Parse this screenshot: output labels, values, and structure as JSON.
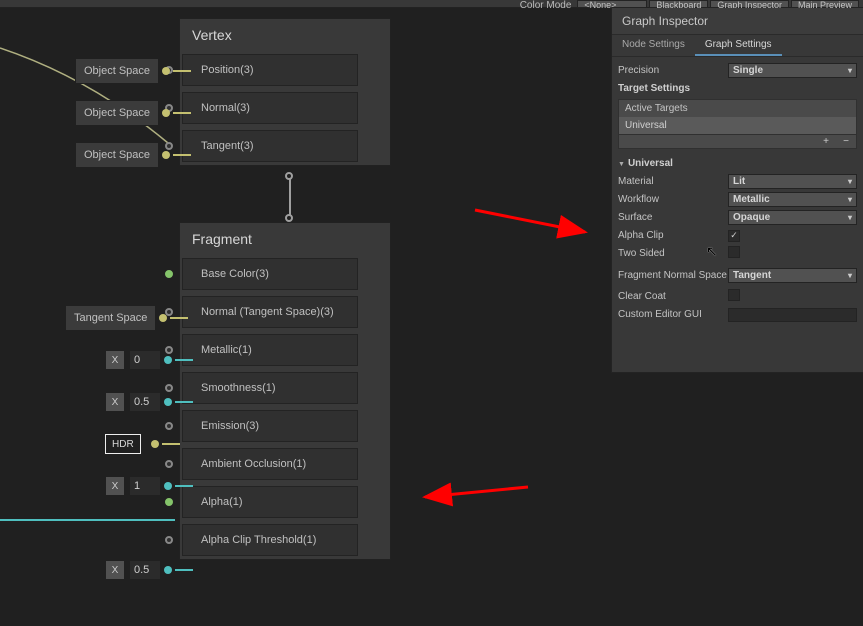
{
  "toolbar": {
    "colorModeLabel": "Color Mode",
    "colorModeValue": "<None>",
    "blackboard": "Blackboard",
    "graphInspector": "Graph Inspector",
    "mainPreview": "Main Preview"
  },
  "vertex": {
    "title": "Vertex",
    "ports": [
      {
        "label": "Position(3)",
        "ext": "Object Space"
      },
      {
        "label": "Normal(3)",
        "ext": "Object Space"
      },
      {
        "label": "Tangent(3)",
        "ext": "Object Space"
      }
    ]
  },
  "fragment": {
    "title": "Fragment",
    "ports": [
      {
        "label": "Base Color(3)",
        "extType": "color"
      },
      {
        "label": "Normal (Tangent Space)(3)",
        "extType": "chip",
        "ext": "Tangent Space"
      },
      {
        "label": "Metallic(1)",
        "extType": "num",
        "ext": "0"
      },
      {
        "label": "Smoothness(1)",
        "extType": "num",
        "ext": "0.5"
      },
      {
        "label": "Emission(3)",
        "extType": "hdr",
        "ext": "HDR"
      },
      {
        "label": "Ambient Occlusion(1)",
        "extType": "num",
        "ext": "1"
      },
      {
        "label": "Alpha(1)",
        "extType": "wire"
      },
      {
        "label": "Alpha Clip Threshold(1)",
        "extType": "num",
        "ext": "0.5"
      }
    ]
  },
  "inspector": {
    "title": "Graph Inspector",
    "tabs": {
      "node": "Node Settings",
      "graph": "Graph Settings"
    },
    "precisionLabel": "Precision",
    "precisionValue": "Single",
    "targetSettings": "Target Settings",
    "activeTargets": "Active Targets",
    "targetItem": "Universal",
    "foldUniversal": "Universal",
    "rows": {
      "materialLabel": "Material",
      "materialValue": "Lit",
      "workflowLabel": "Workflow",
      "workflowValue": "Metallic",
      "surfaceLabel": "Surface",
      "surfaceValue": "Opaque",
      "alphaClipLabel": "Alpha Clip",
      "alphaClipChecked": "✓",
      "twoSidedLabel": "Two Sided",
      "fnsLabel": "Fragment Normal Space",
      "fnsValue": "Tangent",
      "clearCoatLabel": "Clear Coat",
      "customGUILabel": "Custom Editor GUI"
    },
    "plus": "+",
    "minus": "−"
  }
}
